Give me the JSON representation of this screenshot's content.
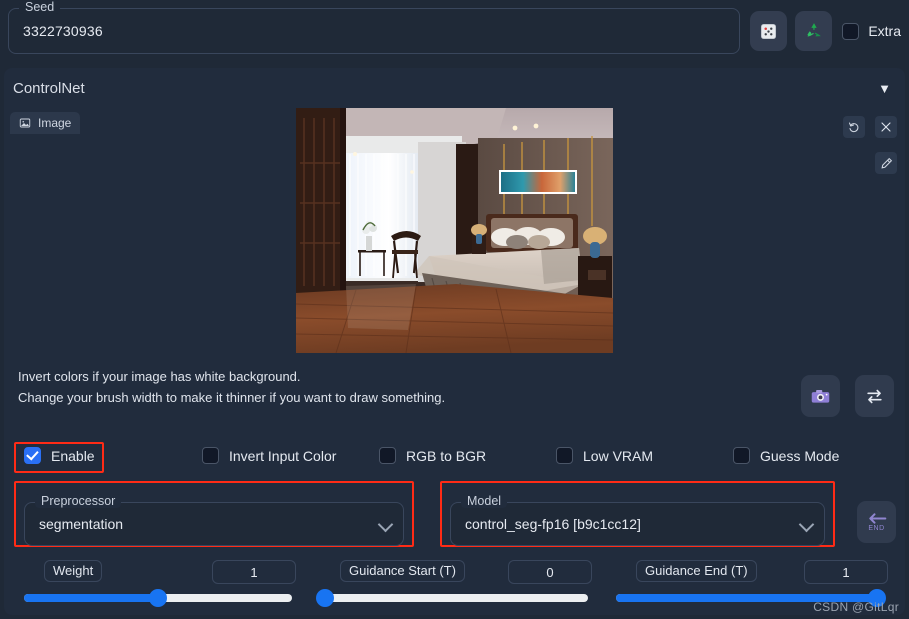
{
  "seed": {
    "label": "Seed",
    "value": "3322730936",
    "dice_icon": "dice-icon",
    "recycle_icon": "recycle-icon",
    "extra_label": "Extra",
    "extra_checked": false
  },
  "controlnet": {
    "title": "ControlNet",
    "collapse_icon": "caret-down-icon",
    "image_tab": {
      "label": "Image",
      "icon": "picture-icon"
    },
    "image_tools": {
      "undo": "undo-icon",
      "close": "close-icon",
      "edit": "pencil-edit-icon"
    },
    "preview_alt": "bedroom-interior-render",
    "hint_line1": "Invert colors if your image has white background.",
    "hint_line2": "Change your brush width to make it thinner if you want to draw something.",
    "camera_icon": "camera-icon",
    "swap_icon": "swap-arrows-icon",
    "checkboxes": [
      {
        "label": "Enable",
        "checked": true,
        "highlighted": true
      },
      {
        "label": "Invert Input Color",
        "checked": false,
        "highlighted": false
      },
      {
        "label": "RGB to BGR",
        "checked": false,
        "highlighted": false
      },
      {
        "label": "Low VRAM",
        "checked": false,
        "highlighted": false
      },
      {
        "label": "Guess Mode",
        "checked": false,
        "highlighted": false
      }
    ],
    "preprocessor": {
      "label": "Preprocessor",
      "value": "segmentation",
      "chevron": "chevron-down-icon",
      "highlighted": true
    },
    "model": {
      "label": "Model",
      "value": "control_seg-fp16 [b9c1cc12]",
      "chevron": "chevron-down-icon",
      "highlighted": true
    },
    "refresh_button": {
      "icon": "arrow-left-end-icon",
      "caption": "END"
    },
    "sliders": [
      {
        "label": "Weight",
        "value": "1",
        "percent": 50
      },
      {
        "label": "Guidance Start (T)",
        "value": "0",
        "percent": 0
      },
      {
        "label": "Guidance End (T)",
        "value": "1",
        "percent": 100
      }
    ]
  },
  "watermark": "CSDN @GitLqr",
  "colors": {
    "page_bg": "#1f2937",
    "panel_bg": "#212c3d",
    "accent_blue": "#1874f2",
    "highlight_red": "#ff2b16",
    "track": "#eceff1"
  }
}
